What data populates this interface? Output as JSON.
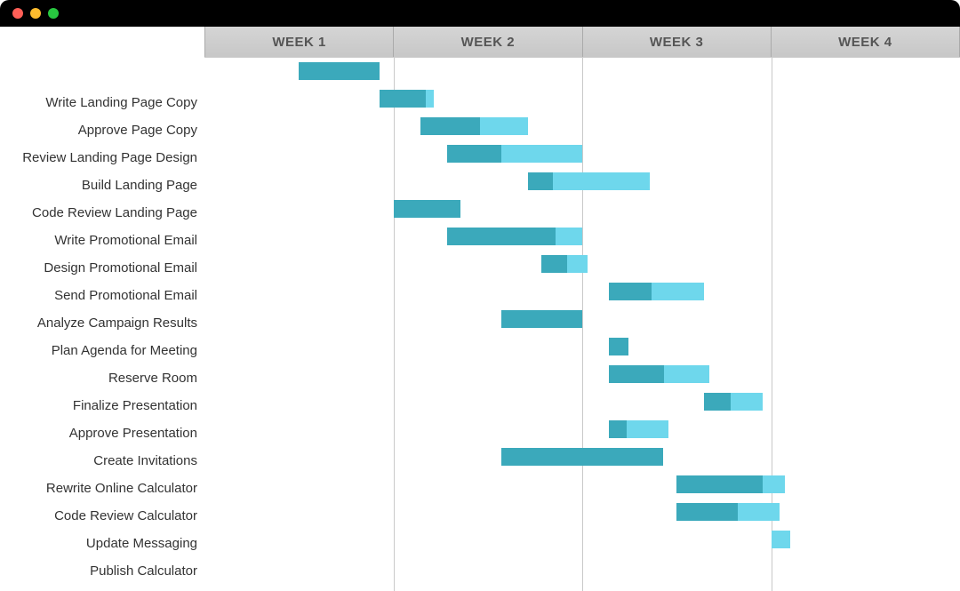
{
  "window": {
    "dots": [
      "red",
      "yellow",
      "green"
    ]
  },
  "header": {
    "weeks": [
      "WEEK 1",
      "WEEK 2",
      "WEEK 3",
      "WEEK 4"
    ]
  },
  "colors": {
    "bar_light": "#6ed7ec",
    "bar_dark": "#3ba9bb"
  },
  "tasks": [
    {
      "label": "Write Landing Page Copy"
    },
    {
      "label": "Approve Page Copy"
    },
    {
      "label": "Review Landing Page Design"
    },
    {
      "label": "Build Landing Page"
    },
    {
      "label": "Code Review Landing Page"
    },
    {
      "label": "Write Promotional Email"
    },
    {
      "label": "Design Promotional Email"
    },
    {
      "label": "Send Promotional Email"
    },
    {
      "label": "Analyze Campaign Results"
    },
    {
      "label": "Plan Agenda for Meeting"
    },
    {
      "label": "Reserve Room"
    },
    {
      "label": "Finalize Presentation"
    },
    {
      "label": "Approve Presentation"
    },
    {
      "label": "Create Invitations"
    },
    {
      "label": "Rewrite Online Calculator"
    },
    {
      "label": "Code Review Calculator"
    },
    {
      "label": "Update Messaging"
    },
    {
      "label": "Publish Calculator"
    }
  ],
  "chart_data": {
    "type": "gantt",
    "title": "",
    "x_unit": "days",
    "x_range_days": [
      0,
      28
    ],
    "week_boundaries_days": [
      0,
      7,
      14,
      21,
      28
    ],
    "columns": [
      "WEEK 1",
      "WEEK 2",
      "WEEK 3",
      "WEEK 4"
    ],
    "series": [
      {
        "name": "Write Landing Page Copy",
        "start_day": 3.5,
        "end_day": 6.5,
        "progress": 1.0
      },
      {
        "name": "Approve Page Copy",
        "start_day": 6.5,
        "end_day": 8.5,
        "progress": 0.85
      },
      {
        "name": "Review Landing Page Design",
        "start_day": 8.0,
        "end_day": 12.0,
        "progress": 0.55
      },
      {
        "name": "Build Landing Page",
        "start_day": 9.0,
        "end_day": 14.0,
        "progress": 0.4
      },
      {
        "name": "Code Review Landing Page",
        "start_day": 12.0,
        "end_day": 16.5,
        "progress": 0.2
      },
      {
        "name": "Write Promotional Email",
        "start_day": 7.0,
        "end_day": 9.5,
        "progress": 1.0
      },
      {
        "name": "Design Promotional Email",
        "start_day": 9.0,
        "end_day": 14.0,
        "progress": 0.8
      },
      {
        "name": "Send Promotional Email",
        "start_day": 12.5,
        "end_day": 14.2,
        "progress": 0.55
      },
      {
        "name": "Analyze Campaign Results",
        "start_day": 15.0,
        "end_day": 18.5,
        "progress": 0.45
      },
      {
        "name": "Plan Agenda for Meeting",
        "start_day": 11.0,
        "end_day": 14.0,
        "progress": 1.0
      },
      {
        "name": "Reserve Room",
        "start_day": 15.0,
        "end_day": 15.7,
        "progress": 1.0
      },
      {
        "name": "Finalize Presentation",
        "start_day": 15.0,
        "end_day": 18.7,
        "progress": 0.55
      },
      {
        "name": "Approve Presentation",
        "start_day": 18.5,
        "end_day": 20.7,
        "progress": 0.45
      },
      {
        "name": "Create Invitations",
        "start_day": 15.0,
        "end_day": 17.2,
        "progress": 0.3
      },
      {
        "name": "Rewrite Online Calculator",
        "start_day": 11.0,
        "end_day": 17.0,
        "progress": 1.0
      },
      {
        "name": "Code Review Calculator",
        "start_day": 17.5,
        "end_day": 21.5,
        "progress": 0.8
      },
      {
        "name": "Update Messaging",
        "start_day": 17.5,
        "end_day": 21.3,
        "progress": 0.6
      },
      {
        "name": "Publish Calculator",
        "start_day": 21.0,
        "end_day": 21.7,
        "progress": 0.0
      }
    ]
  }
}
